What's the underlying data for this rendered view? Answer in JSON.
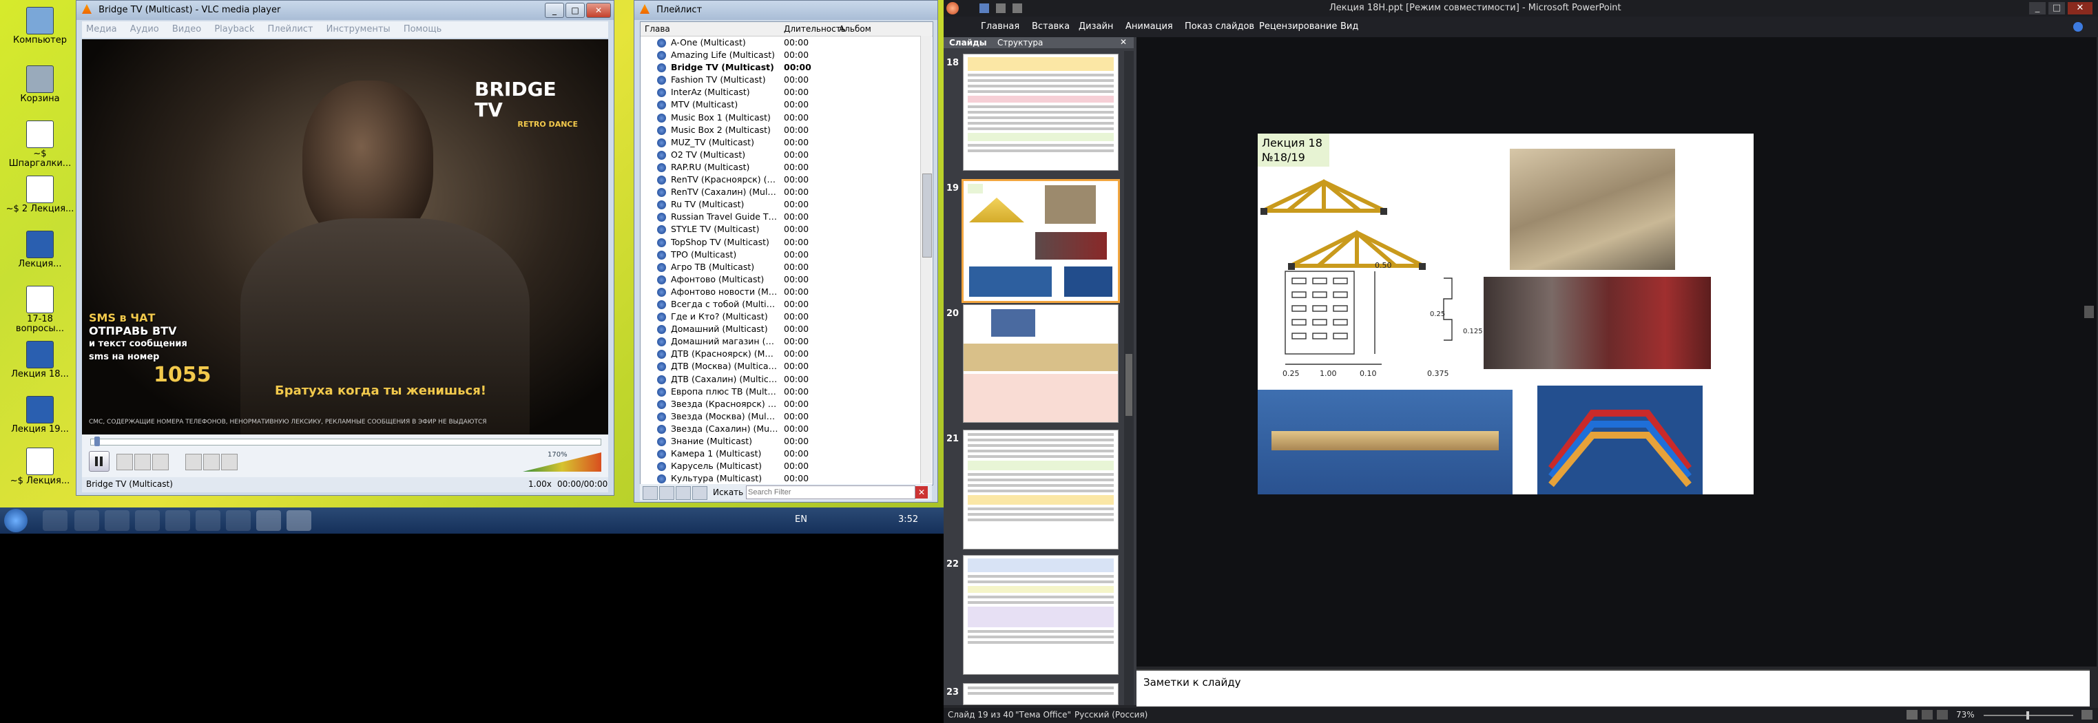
{
  "desktop": {
    "icons": [
      {
        "label": "Компьютер",
        "icon": "computer-icon"
      },
      {
        "label": "Корзина",
        "icon": "recycle-bin-icon"
      },
      {
        "label": "~$ Шпаргалки...",
        "icon": "document-icon"
      },
      {
        "label": "~$ 2 Лекция...",
        "icon": "document-icon"
      },
      {
        "label": "Лекция...",
        "icon": "document-icon"
      },
      {
        "label": "17-18 вопросы...",
        "icon": "document-icon"
      },
      {
        "label": "Лекция 18...",
        "icon": "document-icon"
      },
      {
        "label": "Лекция 19...",
        "icon": "document-icon"
      },
      {
        "label": "~$ Лекция...",
        "icon": "document-icon"
      }
    ]
  },
  "taskbar": {
    "lang": "EN",
    "time": "3:52"
  },
  "vlc": {
    "title": "Bridge TV (Multicast) - VLC media player",
    "menu": [
      "Медиа",
      "Аудио",
      "Видео",
      "Playback",
      "Плейлист",
      "Инструменты",
      "Помощь"
    ],
    "video": {
      "logo": "BRIDGE TV",
      "logo_sub": "RETRO DANCE",
      "promo_line1": "SMS в ЧАТ",
      "promo_line2": "ОТПРАВЬ BTV",
      "promo_line3": "и текст сообщения",
      "promo_line4": "sms на номер",
      "promo_number": "1055",
      "ticker": "Братуха когда ты женишься!",
      "disclaimer": "СМС, СОДЕРЖАЩИЕ НОМЕРА ТЕЛЕФОНОВ, НЕНОРМАТИВНУЮ ЛЕКСИКУ, РЕКЛАМНЫЕ СООБЩЕНИЯ В ЭФИР НЕ ВЫДАЮТСЯ"
    },
    "volume": "170%",
    "status_name": "Bridge TV (Multicast)",
    "speed": "1.00x",
    "time": "00:00/00:00"
  },
  "playlist": {
    "title": "Плейлист",
    "columns": [
      "Глава",
      "Длительность",
      "Альбом"
    ],
    "items": [
      {
        "name": "A-One (Multicast)",
        "dur": "00:00"
      },
      {
        "name": "Amazing Life (Multicast)",
        "dur": "00:00"
      },
      {
        "name": "Bridge TV (Multicast)",
        "dur": "00:00",
        "active": true
      },
      {
        "name": "Fashion TV (Multicast)",
        "dur": "00:00"
      },
      {
        "name": "InterAz (Multicast)",
        "dur": "00:00"
      },
      {
        "name": "MTV (Multicast)",
        "dur": "00:00"
      },
      {
        "name": "Music Box 1 (Multicast)",
        "dur": "00:00"
      },
      {
        "name": "Music Box 2 (Multicast)",
        "dur": "00:00"
      },
      {
        "name": "MUZ_TV (Multicast)",
        "dur": "00:00"
      },
      {
        "name": "O2 TV (Multicast)",
        "dur": "00:00"
      },
      {
        "name": "RAP.RU (Multicast)",
        "dur": "00:00"
      },
      {
        "name": "RenTV (Красноярск) (Mul...",
        "dur": "00:00"
      },
      {
        "name": "RenTV (Сахалин) (Multica...",
        "dur": "00:00"
      },
      {
        "name": "Ru TV (Multicast)",
        "dur": "00:00"
      },
      {
        "name": "Russian Travel Guide TV (...",
        "dur": "00:00"
      },
      {
        "name": "STYLE TV (Multicast)",
        "dur": "00:00"
      },
      {
        "name": "TopShop TV (Multicast)",
        "dur": "00:00"
      },
      {
        "name": "TPO (Multicast)",
        "dur": "00:00"
      },
      {
        "name": "Агро ТВ (Multicast)",
        "dur": "00:00"
      },
      {
        "name": "Афонтово (Multicast)",
        "dur": "00:00"
      },
      {
        "name": "Афонтово новости (Multi...",
        "dur": "00:00"
      },
      {
        "name": "Всегда с тобой (Multicast)",
        "dur": "00:00"
      },
      {
        "name": "Где и Кто? (Multicast)",
        "dur": "00:00"
      },
      {
        "name": "Домашний (Multicast)",
        "dur": "00:00"
      },
      {
        "name": "Домашний магазин (Mul...",
        "dur": "00:00"
      },
      {
        "name": "ДТВ (Красноярск) (Multic...",
        "dur": "00:00"
      },
      {
        "name": "ДТВ (Москва) (Multicast)",
        "dur": "00:00"
      },
      {
        "name": "ДТВ (Сахалин) (Multicast)",
        "dur": "00:00"
      },
      {
        "name": "Европа плюс ТВ (Multicast)",
        "dur": "00:00"
      },
      {
        "name": "Звезда (Красноярск) (Mul...",
        "dur": "00:00"
      },
      {
        "name": "Звезда (Москва) (Multicast)",
        "dur": "00:00"
      },
      {
        "name": "Звезда (Сахалин) (Multic...",
        "dur": "00:00"
      },
      {
        "name": "Знание (Multicast)",
        "dur": "00:00"
      },
      {
        "name": "Камера 1 (Multicast)",
        "dur": "00:00"
      },
      {
        "name": "Карусель (Multicast)",
        "dur": "00:00"
      },
      {
        "name": "Культура (Multicast)",
        "dur": "00:00"
      }
    ],
    "search_label": "Искать",
    "search_placeholder": "Search Filter"
  },
  "ppt": {
    "title": "Лекция 18Н.ppt [Режим совместимости] - Microsoft PowerPoint",
    "ribbon_tabs": [
      "Главная",
      "Вставка",
      "Дизайн",
      "Анимация",
      "Показ слайдов",
      "Рецензирование",
      "Вид"
    ],
    "panel_tabs": [
      "Слайды",
      "Структура"
    ],
    "thumb_numbers": [
      "18",
      "19",
      "20",
      "21",
      "22",
      "23"
    ],
    "slide": {
      "label_line1": "Лекция 18",
      "label_line2": "№18/19",
      "dim_050": "0.50",
      "dim_025": "0.25",
      "dim_100": "1.00",
      "dim_010": "0.10",
      "dim_0375": "0.375",
      "dim_v025": "0.25",
      "dim_v0125": "0.125"
    },
    "notes_placeholder": "Заметки к слайду",
    "status_slide": "Слайд 19 из 40",
    "status_theme": "\"Тема Office\"",
    "status_lang": "Русский (Россия)",
    "zoom": "73%"
  }
}
